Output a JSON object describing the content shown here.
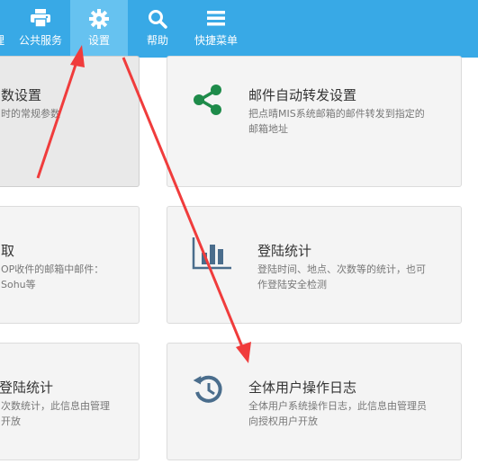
{
  "nav": {
    "items": [
      {
        "label": "理",
        "icon": "cut-off-icon"
      },
      {
        "label": "公共服务",
        "icon": "printer-icon"
      },
      {
        "label": "设置",
        "icon": "gear-icon"
      },
      {
        "label": "帮助",
        "icon": "search-icon"
      },
      {
        "label": "快捷菜单",
        "icon": "hamburger-menu-icon"
      }
    ],
    "active": "设置",
    "bg_color": "#38a9e6",
    "active_color": "#66c2f0"
  },
  "cards": {
    "params": {
      "title": "数设置",
      "desc_line1": "时的常规参数"
    },
    "forward": {
      "title": "邮件自动转发设置",
      "desc_line1": "把点晴MIS系统邮箱的邮件转发到指定的",
      "desc_line2": "邮箱地址",
      "icon": "share-icon",
      "icon_color": "#1e8b4a"
    },
    "fetch": {
      "title": "取",
      "desc_line1": "OP收件的邮箱中邮件：",
      "desc_line2": "Sohu等"
    },
    "login_stats": {
      "title": "登陆统计",
      "desc_line1": "登陆时间、地点、次数等的统计，也可",
      "desc_line2": "作登陆安全检测",
      "icon": "bar-chart-icon",
      "icon_color": "#4a6d8c"
    },
    "login_stats_left": {
      "title": "登陆统计",
      "desc_line1": "次数统计，此信息由管理",
      "desc_line2": "开放"
    },
    "oplog": {
      "title": "全体用户操作日志",
      "desc_line1": "全体用户系统操作日志，此信息由管理员",
      "desc_line2": "向授权用户开放",
      "icon": "history-icon",
      "icon_color": "#4a6d8c"
    }
  },
  "annotation_color": "#f03c3c"
}
